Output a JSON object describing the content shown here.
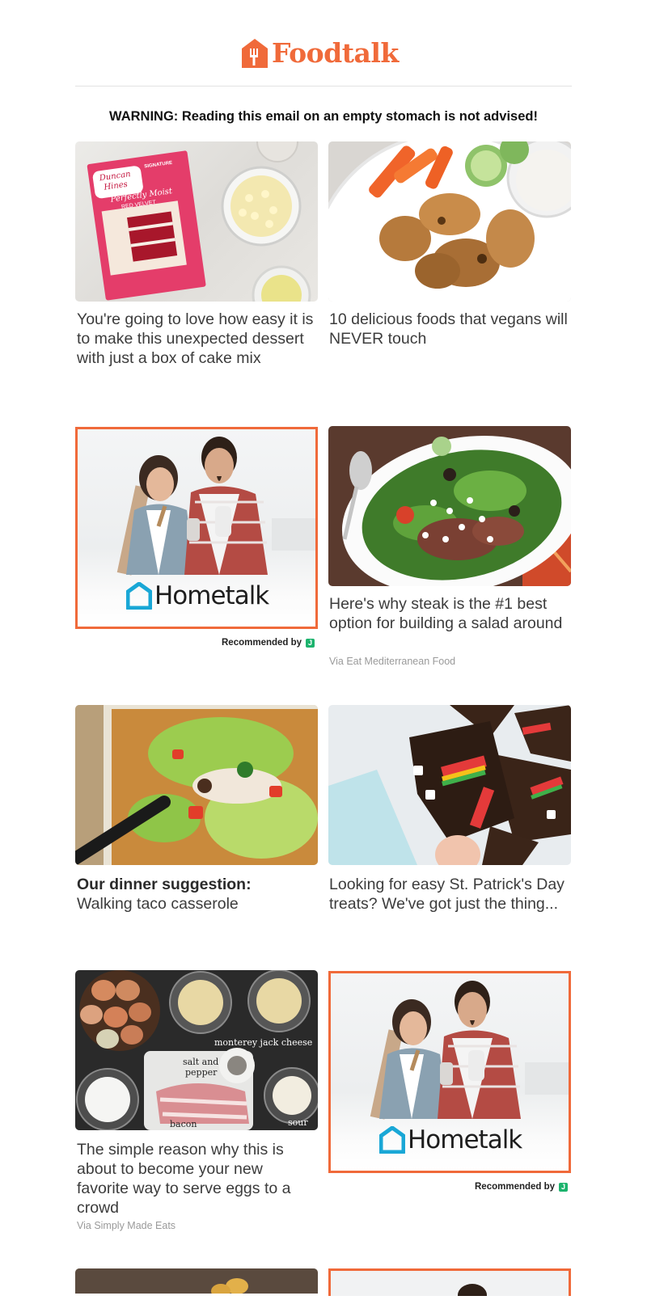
{
  "header": {
    "brand": "Foodtalk"
  },
  "warning": "WARNING: Reading this email on an empty stomach is not advised!",
  "cards": {
    "cake": {
      "title": "You're going to love how easy it is to make this unexpected dessert with just a box of cake mix"
    },
    "vegan": {
      "title": "10 delicious foods that vegans will NEVER touch"
    },
    "steak": {
      "title": "Here's why steak is the #1 best option for building a salad around",
      "via": "Via Eat Mediterranean Food"
    },
    "taco": {
      "bold": "Our dinner suggestion:",
      "title": "Walking taco casserole"
    },
    "stpatrick": {
      "title": "Looking for easy St. Patrick's Day treats? We've got just the thing..."
    },
    "eggs": {
      "title": "The simple reason why this is about to become your new favorite way to serve eggs to a crowd",
      "via": "Via Simply Made Eats",
      "labels": {
        "cheese": "monterey jack cheese",
        "salt": "salt and",
        "pepper": "pepper",
        "bacon": "bacon",
        "sour": "sour"
      }
    }
  },
  "cake_box": {
    "brand_line1": "Duncan",
    "brand_line2": "Hines",
    "signature": "SIGNATURE",
    "line1": "Perfectly Moist",
    "line2": "RED VELVET"
  },
  "ads": {
    "brand": "Hometalk",
    "recommended": "Recommended by",
    "badge": "J"
  },
  "colors": {
    "brand": "#f06a3a",
    "hometalk_icon": "#19a7d6",
    "badge": "#1cb36d"
  }
}
